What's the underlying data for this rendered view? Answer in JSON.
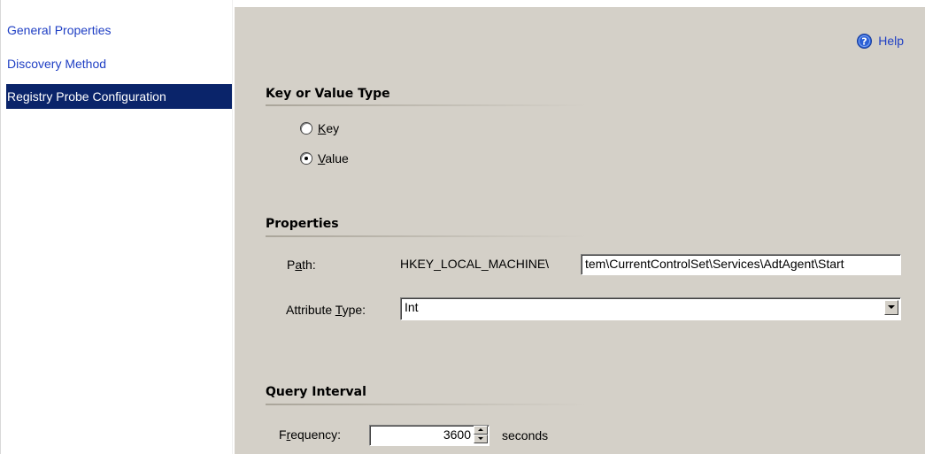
{
  "sidebar": {
    "items": [
      {
        "label": "General Properties",
        "selected": false
      },
      {
        "label": "Discovery Method",
        "selected": false
      },
      {
        "label": "Registry Probe Configuration",
        "selected": true
      }
    ]
  },
  "help": {
    "label": "Help",
    "icon": "help-icon"
  },
  "key_value_section": {
    "title": "Key or Value Type",
    "options": [
      {
        "accel": "K",
        "rest": "ey",
        "checked": false
      },
      {
        "accel": "V",
        "rest": "alue",
        "checked": true
      }
    ]
  },
  "properties": {
    "title": "Properties",
    "path_label_pre": "P",
    "path_label_accel": "a",
    "path_label_post": "th:",
    "path_prefix": "HKEY_LOCAL_MACHINE\\",
    "path_value": "tem\\CurrentControlSet\\Services\\AdtAgent\\Start",
    "attr_label_pre": "Attribute ",
    "attr_label_accel": "T",
    "attr_label_post": "ype:",
    "attr_value": "Int"
  },
  "query_interval": {
    "title": "Query Interval",
    "freq_label_pre": "F",
    "freq_label_accel": "r",
    "freq_label_post": "equency:",
    "freq_value": "3600",
    "freq_unit": "seconds"
  },
  "colors": {
    "link": "#1f3fc4",
    "selected_bg": "#0a246a",
    "panel_bg": "#d4d0c8"
  }
}
